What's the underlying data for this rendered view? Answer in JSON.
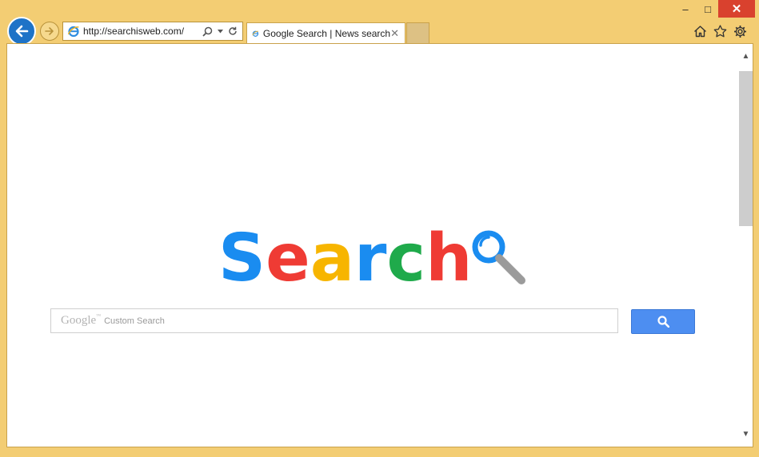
{
  "browser": {
    "address_url": "http://searchisweb.com/",
    "tab_title": "Google Search | News search",
    "window_buttons": {
      "minimize": "‒",
      "maximize": "□",
      "close": "✕"
    },
    "icons": [
      "back-arrow-icon",
      "forward-arrow-icon",
      "ie-logo-icon",
      "search-icon",
      "dropdown-icon",
      "refresh-icon",
      "home-icon",
      "favorites-star-icon",
      "settings-gear-icon"
    ]
  },
  "page": {
    "logo_letters": [
      {
        "char": "S",
        "color": "#1a8cf0"
      },
      {
        "char": "e",
        "color": "#ef3b34"
      },
      {
        "char": "a",
        "color": "#f7b500"
      },
      {
        "char": "r",
        "color": "#1a8cf0"
      },
      {
        "char": "c",
        "color": "#1faa4b"
      },
      {
        "char": "h",
        "color": "#ef3b34"
      }
    ],
    "search": {
      "google_label": "Google",
      "trademark": "™",
      "placeholder": "Custom Search",
      "button_icon": "search-icon",
      "button_color": "#4d8ef1"
    }
  }
}
